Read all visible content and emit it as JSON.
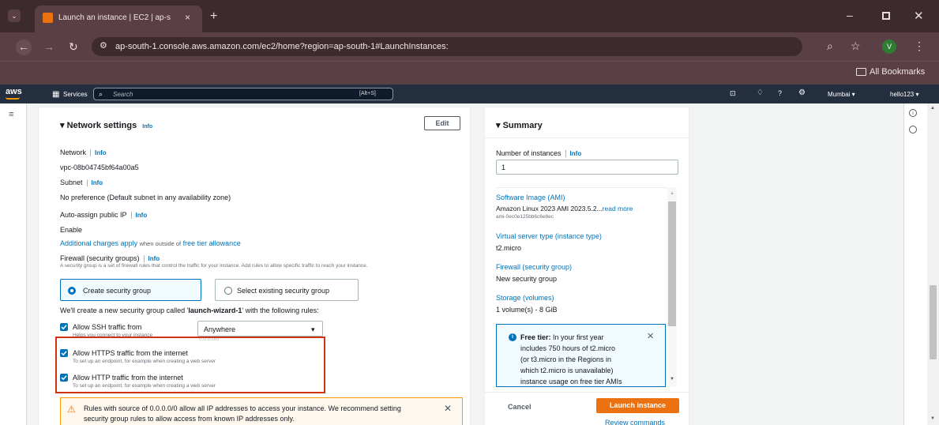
{
  "browser": {
    "tab_title": "Launch an instance | EC2 | ap-s",
    "url": "ap-south-1.console.aws.amazon.com/ec2/home?region=ap-south-1#LaunchInstances:",
    "profile_initial": "V",
    "bookmarks_label": "All Bookmarks"
  },
  "aws_header": {
    "logo": "aws",
    "services_label": "Services",
    "search_placeholder": "Search",
    "search_shortcut": "[Alt+S]",
    "region": "Mumbai",
    "account": "hello123"
  },
  "network": {
    "title": "Network settings",
    "info": "Info",
    "edit_label": "Edit",
    "network_label": "Network",
    "network_value": "vpc-08b04745bf64a00a5",
    "subnet_label": "Subnet",
    "subnet_value": "No preference (Default subnet in any availability zone)",
    "public_ip_label": "Auto-assign public IP",
    "public_ip_value": "Enable",
    "charges_link": "Additional charges apply",
    "charges_mid": "when outside of",
    "charges_link2": "free tier allowance",
    "firewall_label": "Firewall (security groups)",
    "firewall_desc": "A security group is a set of firewall rules that control the traffic for your instance. Add rules to allow specific traffic to reach your instance.",
    "create_sg": "Create security group",
    "select_sg": "Select existing security group",
    "create_msg_pre": "We'll create a new security group called '",
    "sg_name": "launch-wizard-1",
    "create_msg_post": "' with the following rules:",
    "ssh_label": "Allow SSH traffic from",
    "ssh_hint": "Helps you connect to your instance",
    "ssh_source": "Anywhere",
    "ssh_cidr": "0.0.0.0/0",
    "https_label": "Allow HTTPS traffic from the internet",
    "https_hint": "To set up an endpoint, for example when creating a web server",
    "http_label": "Allow HTTP traffic from the internet",
    "http_hint": "To set up an endpoint, for example when creating a web server",
    "warning_line1": "Rules with source of 0.0.0.0/0 allow all IP addresses to access your instance. We recommend setting",
    "warning_line2": "security group rules to allow access from known IP addresses only."
  },
  "summary": {
    "title": "Summary",
    "instances_label": "Number of instances",
    "info": "Info",
    "instances_value": "1",
    "ami_label": "Software Image (AMI)",
    "ami_value": "Amazon Linux 2023 AMI 2023.5.2...",
    "ami_more": "read more",
    "ami_id": "ami-0ec0e125bb6c6e8ec",
    "type_label": "Virtual server type (instance type)",
    "type_value": "t2.micro",
    "firewall_label": "Firewall (security group)",
    "firewall_value": "New security group",
    "storage_label": "Storage (volumes)",
    "storage_value": "1 volume(s) - 8 GiB",
    "free_tier_bold": "Free tier:",
    "free_tier_l1": "In your first year",
    "free_tier_l2": "includes 750 hours of t2.micro",
    "free_tier_l3": "(or t3.micro in the Regions in",
    "free_tier_l4": "which t2.micro is unavailable)",
    "free_tier_l5": "instance usage on free tier AMIs",
    "cancel_label": "Cancel",
    "launch_label": "Launch instance",
    "review_label": "Review commands"
  },
  "colors": {
    "aws_nav": "#232f3e",
    "link": "#0073bb",
    "launch": "#ec7211",
    "highlight": "#d13212"
  }
}
